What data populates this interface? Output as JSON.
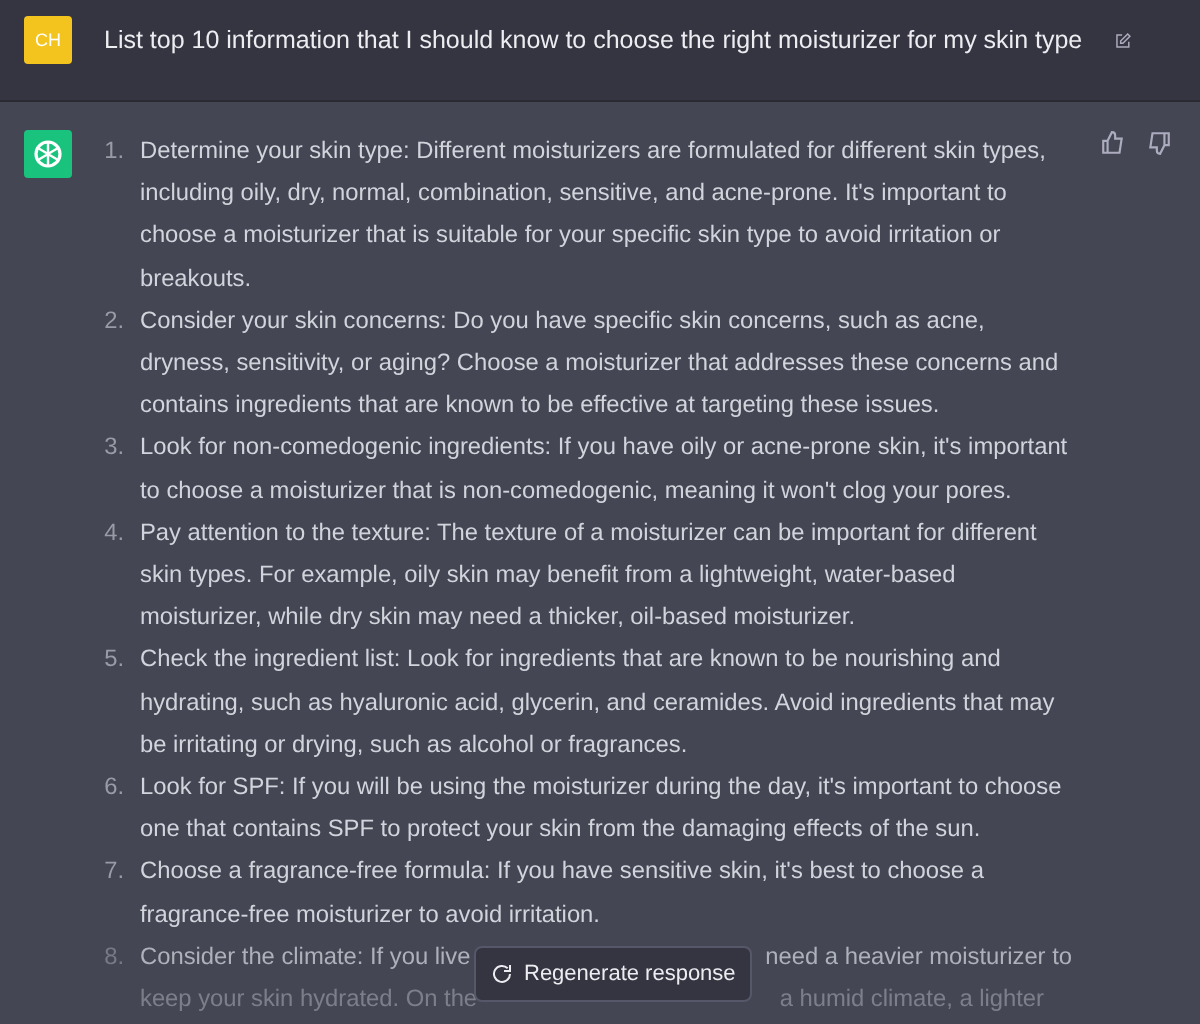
{
  "prompt": {
    "avatar": "CH",
    "text": "List top 10 information that I should know to choose the right moisturizer for my skin type"
  },
  "answer": {
    "items": [
      {
        "number": "1.",
        "text": "Determine your skin type: Different moisturizers are formulated for different skin types, including oily, dry, normal, combination, sensitive, and acne-prone. It's important to choose a moisturizer that is suitable for your specific skin type to avoid irritation or breakouts."
      },
      {
        "number": "2.",
        "text": "Consider your skin concerns: Do you have specific skin concerns, such as acne, dryness, sensitivity, or aging? Choose a moisturizer that addresses these concerns and contains ingredients that are known to be effective at targeting these issues."
      },
      {
        "number": "3.",
        "text": "Look for non-comedogenic ingredients: If you have oily or acne-prone skin, it's important to choose a moisturizer that is non-comedogenic, meaning it won't clog your pores."
      },
      {
        "number": "4.",
        "text": "Pay attention to the texture: The texture of a moisturizer can be important for different skin types. For example, oily skin may benefit from a lightweight, water-based moisturizer, while dry skin may need a thicker, oil-based moisturizer."
      },
      {
        "number": "5.",
        "text": "Check the ingredient list: Look for ingredients that are known to be nourishing and hydrating, such as hyaluronic acid, glycerin, and ceramides. Avoid ingredients that may be irritating or drying, such as alcohol or fragrances."
      },
      {
        "number": "6.",
        "text": "Look for SPF: If you will be using the moisturizer during the day, it's important to choose one that contains SPF to protect your skin from the damaging effects of the sun."
      },
      {
        "number": "7.",
        "text": "Choose a fragrance-free formula: If you have sensitive skin, it's best to choose a fragrance-free moisturizer to avoid irritation."
      }
    ],
    "partial_item": {
      "number": "8.",
      "lines": [
        {
          "left": "Consider the climate: If you live",
          "right": "need a heavier moisturizer to"
        },
        {
          "left": "keep your skin hydrated. On the",
          "right": "a humid climate, a lighter"
        }
      ]
    }
  },
  "regenerate_button": "Regenerate response"
}
